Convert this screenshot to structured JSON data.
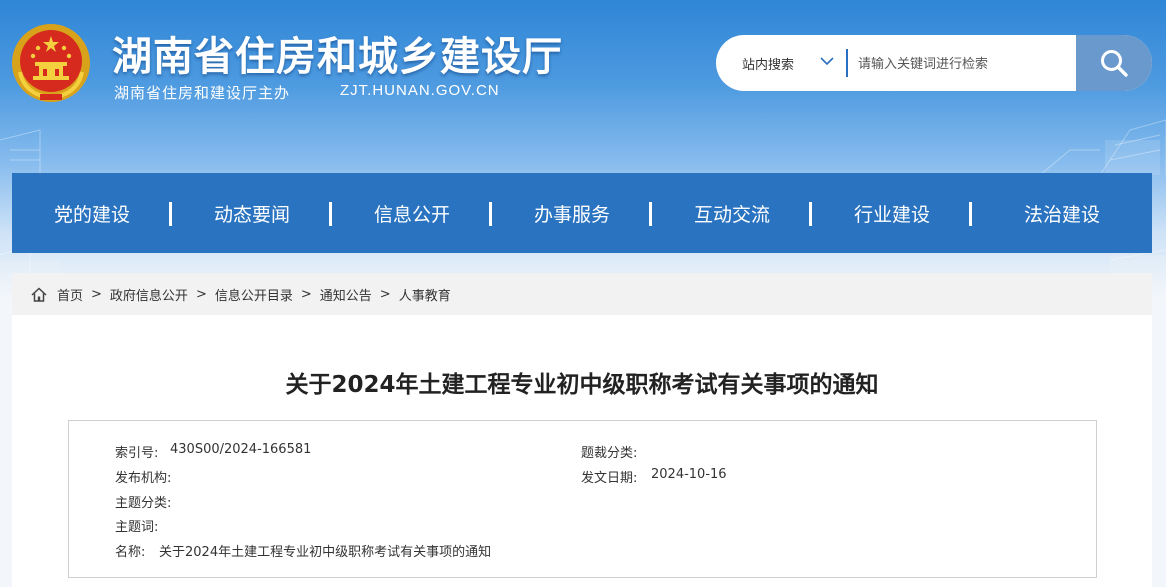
{
  "header": {
    "title": "湖南省住房和城乡建设厅",
    "subtitle": "湖南省住房和建设厅主办",
    "domain": "ZJT.HUNAN.GOV.CN"
  },
  "search": {
    "scope_label": "站内搜索",
    "placeholder": "请输入关键词进行检索"
  },
  "nav": {
    "items": [
      "党的建设",
      "动态要闻",
      "信息公开",
      "办事服务",
      "互动交流",
      "行业建设",
      "法治建设"
    ]
  },
  "breadcrumb": {
    "items": [
      "首页",
      "政府信息公开",
      "信息公开目录",
      "通知公告",
      "人事教育"
    ],
    "separator": ">"
  },
  "article": {
    "title": "关于2024年土建工程专业初中级职称考试有关事项的通知",
    "meta": {
      "index_label": "索引号:",
      "index_value": "430S00/2024-166581",
      "category_label": "题裁分类:",
      "category_value": "",
      "publisher_label": "发布机构:",
      "publisher_value": "",
      "date_label": "发文日期:",
      "date_value": "2024-10-16",
      "topic_label": "主题分类:",
      "topic_value": "",
      "keywords_label": "主题词:",
      "keywords_value": "",
      "name_label": "名称:",
      "name_value": "关于2024年土建工程专业初中级职称考试有关事项的通知"
    }
  },
  "colors": {
    "nav_bg": "#2a73c0",
    "search_button": "#6a9acd",
    "header_top": "#2f86d6"
  },
  "icons": {
    "emblem": "national-emblem-icon",
    "search": "search-icon",
    "dropdown": "chevron-down-icon",
    "home": "home-icon"
  }
}
